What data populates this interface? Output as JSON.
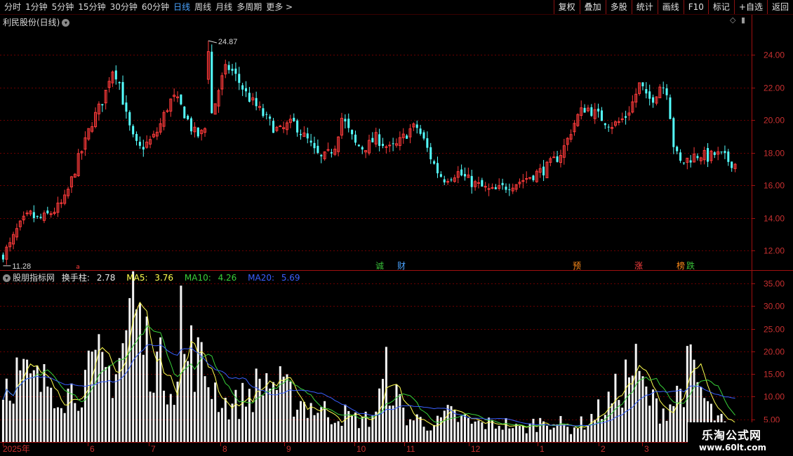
{
  "toolbar": {
    "periods": [
      "分时",
      "1分钟",
      "5分钟",
      "15分钟",
      "30分钟",
      "60分钟",
      "日线",
      "周线",
      "月线",
      "多周期",
      "更多"
    ],
    "active_period": "日线",
    "more_arrow": ">",
    "buttons": [
      "复权",
      "叠加",
      "多股",
      "统计",
      "画线",
      "F10",
      "标记",
      "+自选",
      "返回"
    ]
  },
  "price_panel": {
    "title": "利民股份(日线)",
    "high_label": "24.87",
    "low_label": "11.28",
    "y_ticks": [
      "24.00",
      "22.00",
      "20.00",
      "18.00",
      "16.00",
      "14.00",
      "12.00"
    ],
    "markers": [
      {
        "text": "诚",
        "color": "#39c039"
      },
      {
        "text": "财",
        "color": "#4aa3ff"
      },
      {
        "text": "预",
        "color": "#ff8c1a"
      },
      {
        "text": "涨",
        "color": "#ff4040"
      },
      {
        "text": "榜",
        "color": "#ff8c1a"
      },
      {
        "text": "跌",
        "color": "#39c039"
      }
    ],
    "small_red_marker": "a"
  },
  "indicator": {
    "name": "股朋指标网",
    "label": "换手柱:",
    "value": "2.78",
    "ma5_label": "MA5:",
    "ma5": "3.76",
    "ma10_label": "MA10:",
    "ma10": "4.26",
    "ma20_label": "MA20:",
    "ma20": "5.69",
    "colors": {
      "ma5": "#ffff50",
      "ma10": "#39d039",
      "ma20": "#3a60ff"
    },
    "y_ticks": [
      "35.00",
      "30.00",
      "25.00",
      "20.00",
      "15.00",
      "10.00",
      "5.00"
    ]
  },
  "x_axis": {
    "labels": [
      "2025年",
      "6",
      "7",
      "8",
      "9",
      "10",
      "11",
      "12",
      "1",
      "2",
      "3"
    ]
  },
  "watermark": {
    "line1": "乐淘公式网",
    "line2": "www.60lt.com"
  },
  "colors": {
    "up": "#ff3b3b",
    "down": "#54ffff",
    "grid": "#6a0000",
    "border": "#a01010"
  },
  "chart_data": [
    {
      "type": "candlestick",
      "title": "利民股份(日线)",
      "y_ticks": [
        24,
        22,
        20,
        18,
        16,
        14,
        12
      ],
      "ylim": [
        10.8,
        25.6
      ],
      "high": 24.87,
      "low": 11.28,
      "close_path": [
        11.8,
        12.3,
        13.2,
        13.8,
        14.2,
        13.9,
        14.0,
        14.3,
        14.6,
        15.0,
        16.2,
        17.5,
        18.5,
        19.8,
        20.6,
        21.5,
        23.2,
        22.6,
        20.5,
        19.0,
        18.2,
        18.5,
        18.8,
        19.5,
        20.6,
        21.4,
        21.0,
        20.2,
        19.3,
        19.0,
        19.6,
        20.6,
        22.2,
        23.3,
        22.9,
        22.2,
        21.5,
        21.0,
        20.5,
        20.0,
        19.5,
        19.3,
        19.7,
        19.8,
        19.2,
        18.7,
        18.0,
        17.6,
        17.9,
        18.5,
        20.2,
        19.3,
        18.5,
        18.3,
        18.5,
        18.9,
        18.6,
        18.2,
        18.4,
        18.9,
        19.4,
        19.6,
        18.8,
        17.8,
        16.9,
        16.4,
        16.6,
        16.8,
        16.5,
        16.2,
        16.0,
        15.8,
        15.6,
        15.7,
        15.9,
        16.1,
        16.2,
        16.4,
        16.6,
        16.8,
        17.0,
        17.4,
        17.8,
        18.5,
        19.6,
        20.4,
        20.8,
        20.5,
        20.2,
        19.9,
        19.7,
        19.9,
        20.3,
        21.2,
        22.3,
        21.2,
        21.4,
        22.2,
        21.8,
        18.2,
        17.3,
        17.6,
        17.8,
        17.9,
        17.7,
        17.9,
        17.8,
        17.5,
        17.3
      ]
    },
    {
      "type": "bar",
      "title": "股朋指标网",
      "series_name": "换手柱",
      "ylim": [
        0,
        37
      ],
      "y_ticks": [
        35,
        30,
        25,
        20,
        15,
        10,
        5
      ],
      "last": {
        "value": 2.78,
        "MA5": 3.76,
        "MA10": 4.26,
        "MA20": 5.69
      },
      "values_path": [
        13,
        14,
        15,
        15,
        14,
        13,
        13,
        12,
        14,
        13,
        12,
        11,
        11,
        12,
        13,
        14,
        15,
        17,
        16,
        15,
        17,
        20,
        25,
        34,
        27,
        22,
        20,
        18,
        16,
        15,
        14,
        14,
        17,
        20,
        19,
        17,
        15,
        13,
        11,
        9,
        8,
        8,
        9,
        10,
        11,
        12,
        13,
        14,
        13,
        12,
        11,
        10,
        9,
        9,
        8,
        8,
        7,
        7,
        6,
        6,
        6,
        6,
        5,
        5,
        5,
        5,
        7,
        10,
        15,
        13,
        9,
        7,
        5,
        5,
        5,
        4,
        4,
        4,
        5,
        6,
        6,
        5,
        5,
        4,
        4,
        4,
        4,
        4,
        4,
        4,
        4,
        3,
        3,
        3,
        4,
        4,
        5,
        5,
        4,
        4,
        3,
        3,
        4,
        4,
        5,
        6,
        7,
        8,
        9,
        11,
        13,
        15,
        17,
        14,
        11,
        9,
        8,
        7,
        8,
        9,
        11,
        14,
        16,
        14,
        11,
        8,
        6,
        5,
        4,
        3,
        3
      ]
    }
  ]
}
